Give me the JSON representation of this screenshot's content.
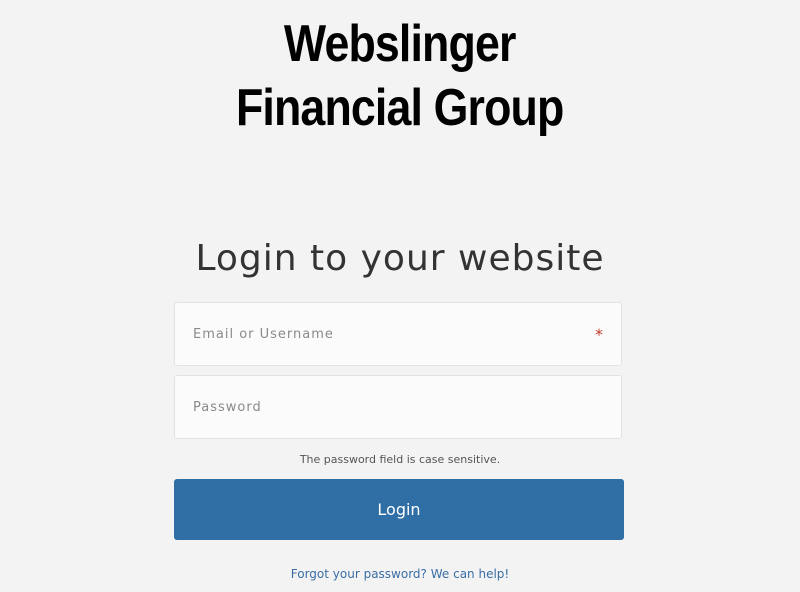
{
  "logo": {
    "line1": "Webslinger",
    "line2": "Financial Group"
  },
  "heading": "Login to your website",
  "email_field": {
    "placeholder": "Email or Username",
    "value": "",
    "required_marker": "*"
  },
  "password_field": {
    "placeholder": "Password",
    "value": ""
  },
  "hint": "The password field is case sensitive.",
  "login_button": "Login",
  "forgot_link": "Forgot your password? We can help!",
  "colors": {
    "background": "#f3f3f3",
    "button": "#2f6fa6",
    "link": "#3a6ea5",
    "required": "#c0392b"
  }
}
